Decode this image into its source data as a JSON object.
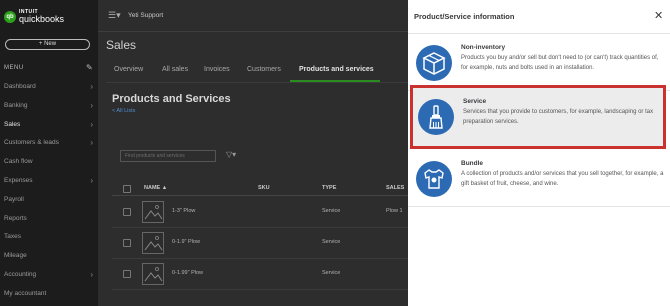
{
  "brand": {
    "intuit": "INTUIT",
    "product": "quickbooks",
    "badge": "qb"
  },
  "sidebar": {
    "new_label": "+ New",
    "menu_header": "MENU",
    "items": [
      {
        "label": "Dashboard",
        "chevron": true
      },
      {
        "label": "Banking",
        "chevron": true
      },
      {
        "label": "Sales",
        "chevron": true,
        "active": true
      },
      {
        "label": "Customers & leads",
        "chevron": true
      },
      {
        "label": "Cash flow",
        "chevron": false
      },
      {
        "label": "Expenses",
        "chevron": true
      },
      {
        "label": "Payroll",
        "chevron": false
      },
      {
        "label": "Reports",
        "chevron": false
      },
      {
        "label": "Taxes",
        "chevron": false
      },
      {
        "label": "Mileage",
        "chevron": false
      },
      {
        "label": "Accounting",
        "chevron": true
      },
      {
        "label": "My accountant",
        "chevron": false
      }
    ]
  },
  "header": {
    "company": "Yeti Support"
  },
  "page": {
    "title": "Sales",
    "tabs": [
      "Overview",
      "All sales",
      "Invoices",
      "Customers",
      "Products and services"
    ],
    "active_tab": "Products and services",
    "section_title": "Products and Services",
    "back_link": "< All Lists",
    "filter_placeholder": "Find products and services"
  },
  "table": {
    "columns": [
      "NAME ▲",
      "SKU",
      "TYPE",
      "SALES"
    ],
    "rows": [
      {
        "name": "1-3\" Plow",
        "sku": "",
        "type": "Service",
        "sales": "Plow 1"
      },
      {
        "name": "0-1.9\" Plow",
        "sku": "",
        "type": "Service",
        "sales": ""
      },
      {
        "name": "0-1.99\" Plow",
        "sku": "",
        "type": "Service",
        "sales": ""
      }
    ]
  },
  "drawer": {
    "title": "Product/Service information",
    "options": [
      {
        "name": "Non-inventory",
        "description": "Products you buy and/or sell but don't need to (or can't) track quantities of, for example, nuts and bolts used in an installation.",
        "icon": "box-icon"
      },
      {
        "name": "Service",
        "description": "Services that you provide to customers, for example, landscaping or tax preparation services.",
        "icon": "paintbrush-icon",
        "highlighted": true
      },
      {
        "name": "Bundle",
        "description": "A collection of products and/or services that you sell together, for example, a gift basket of fruit, cheese, and wine.",
        "icon": "shirt-icon"
      }
    ]
  },
  "colors": {
    "accent": "#2ca01c",
    "icon_blue": "#2d6ab4",
    "highlight_border": "#c9322e"
  }
}
